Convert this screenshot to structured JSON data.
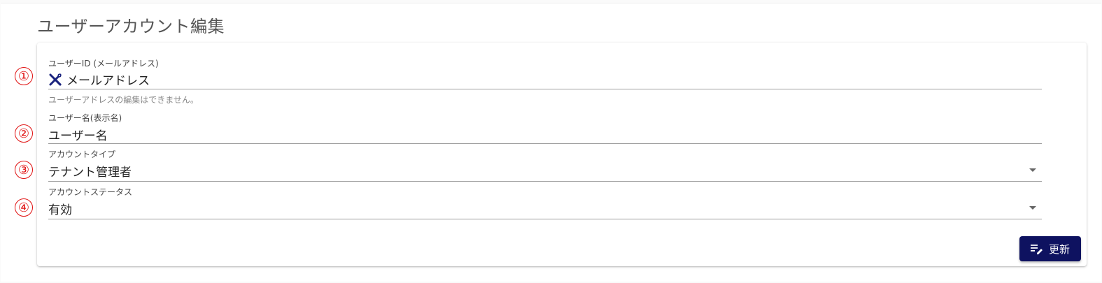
{
  "page": {
    "title": "ユーザーアカウント編集"
  },
  "markers": [
    "①",
    "②",
    "③",
    "④"
  ],
  "form": {
    "user_id": {
      "label": "ユーザーID (メールアドレス)",
      "value": "メールアドレス",
      "hint": "ユーザーアドレスの編集はできません。",
      "icon": "tools-icon"
    },
    "user_name": {
      "label": "ユーザー名(表示名)",
      "value": "ユーザー名"
    },
    "account_type": {
      "label": "アカウントタイプ",
      "value": "テナント管理者"
    },
    "account_status": {
      "label": "アカウントステータス",
      "value": "有効"
    }
  },
  "actions": {
    "update_label": "更新",
    "update_icon": "edit-list-icon",
    "button_color": "#0e1260"
  }
}
